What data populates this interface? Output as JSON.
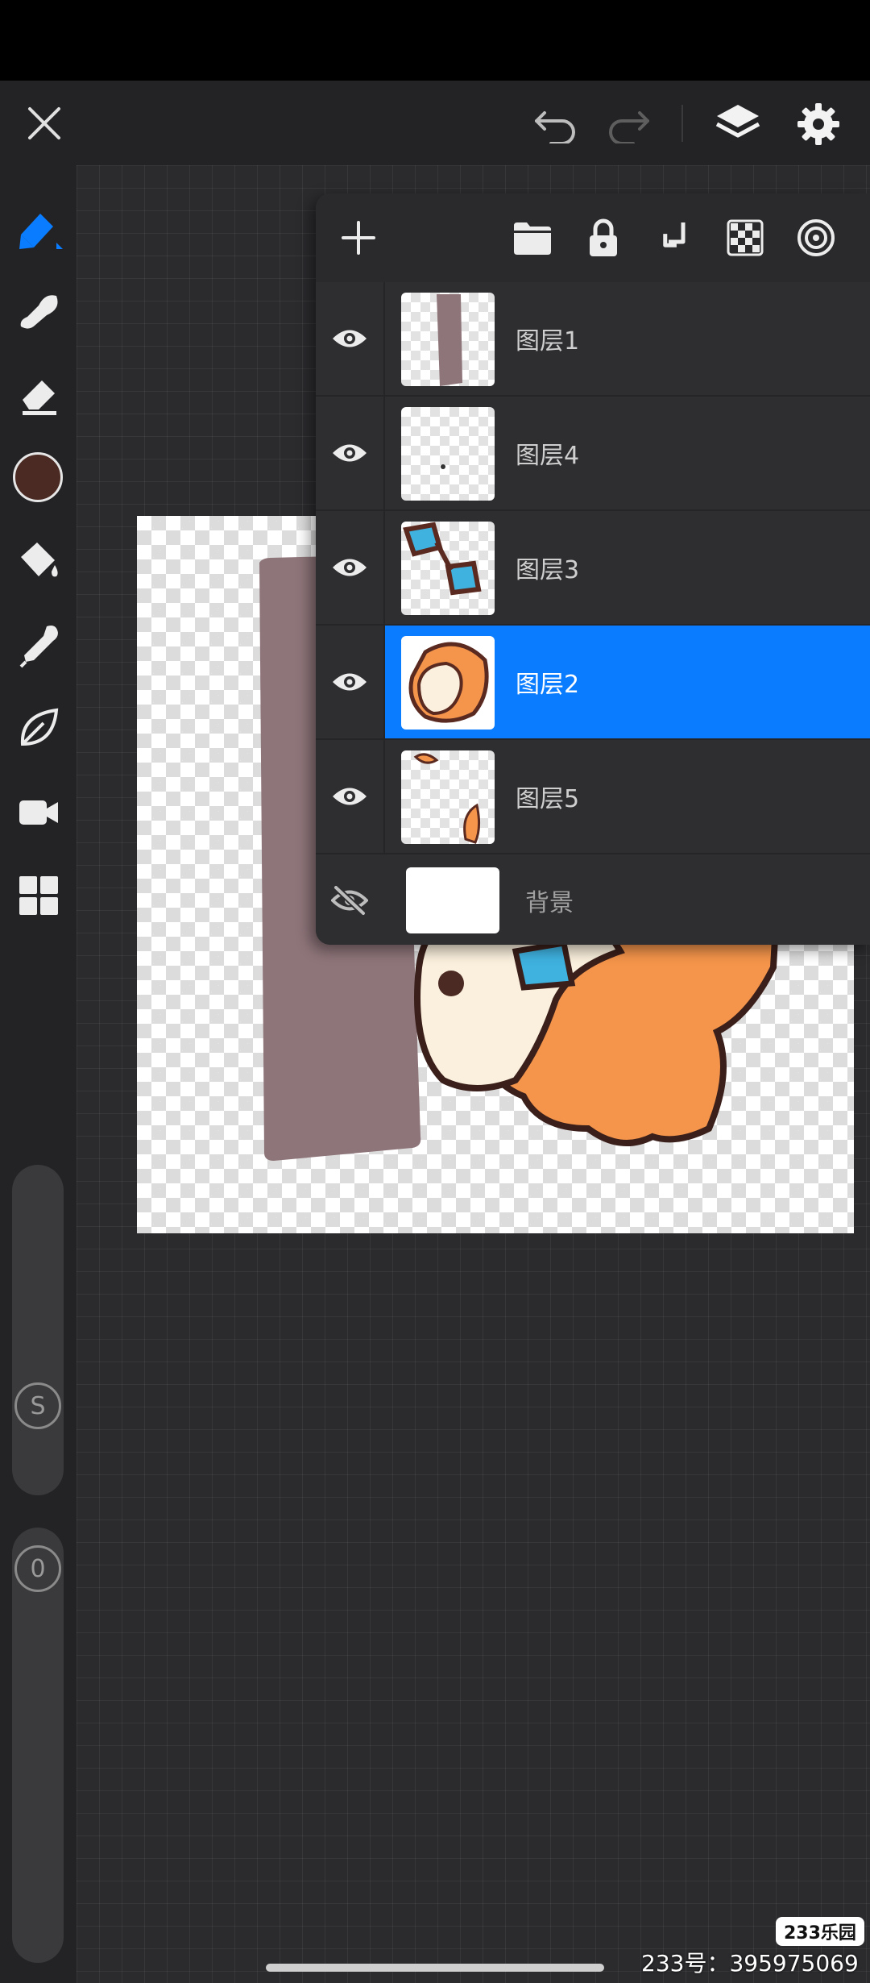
{
  "layers_panel": {
    "layers": [
      {
        "name": "图层1",
        "visible": true,
        "selected": false
      },
      {
        "name": "图层4",
        "visible": true,
        "selected": false
      },
      {
        "name": "图层3",
        "visible": true,
        "selected": false
      },
      {
        "name": "图层2",
        "visible": true,
        "selected": true
      },
      {
        "name": "图层5",
        "visible": true,
        "selected": false
      }
    ],
    "background": {
      "name": "背景",
      "visible": false
    }
  },
  "tools": {
    "current_color": "#4a2a22",
    "accent": "#0a7cff"
  },
  "sliders": {
    "size_label": "S",
    "opacity_label": "0"
  },
  "watermark": {
    "logo": "233乐园",
    "id_text": "233号：395975069"
  }
}
